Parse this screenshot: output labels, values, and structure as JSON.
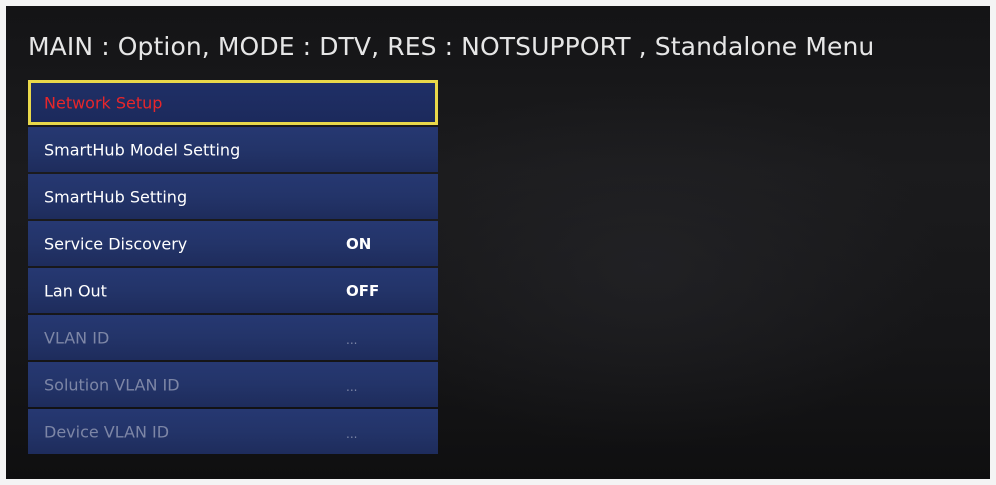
{
  "header": {
    "title": "MAIN : Option, MODE : DTV, RES : NOTSUPPORT , Standalone Menu"
  },
  "menu": {
    "items": [
      {
        "label": "Network Setup",
        "value": "",
        "state": "selected"
      },
      {
        "label": "SmartHub Model Setting",
        "value": "",
        "state": "normal"
      },
      {
        "label": "SmartHub Setting",
        "value": "",
        "state": "normal"
      },
      {
        "label": "Service Discovery",
        "value": "ON",
        "state": "normal"
      },
      {
        "label": "Lan Out",
        "value": "OFF",
        "state": "normal"
      },
      {
        "label": "VLAN ID",
        "value": "...",
        "state": "disabled"
      },
      {
        "label": "Solution VLAN ID",
        "value": "...",
        "state": "disabled"
      },
      {
        "label": "Device VLAN ID",
        "value": "...",
        "state": "disabled"
      }
    ]
  },
  "colors": {
    "menu_background": "#233469",
    "selection_border": "#e9d84a",
    "selected_text": "#e8262b",
    "disabled_text": "#7d86a6",
    "screen_background": "#161618"
  }
}
